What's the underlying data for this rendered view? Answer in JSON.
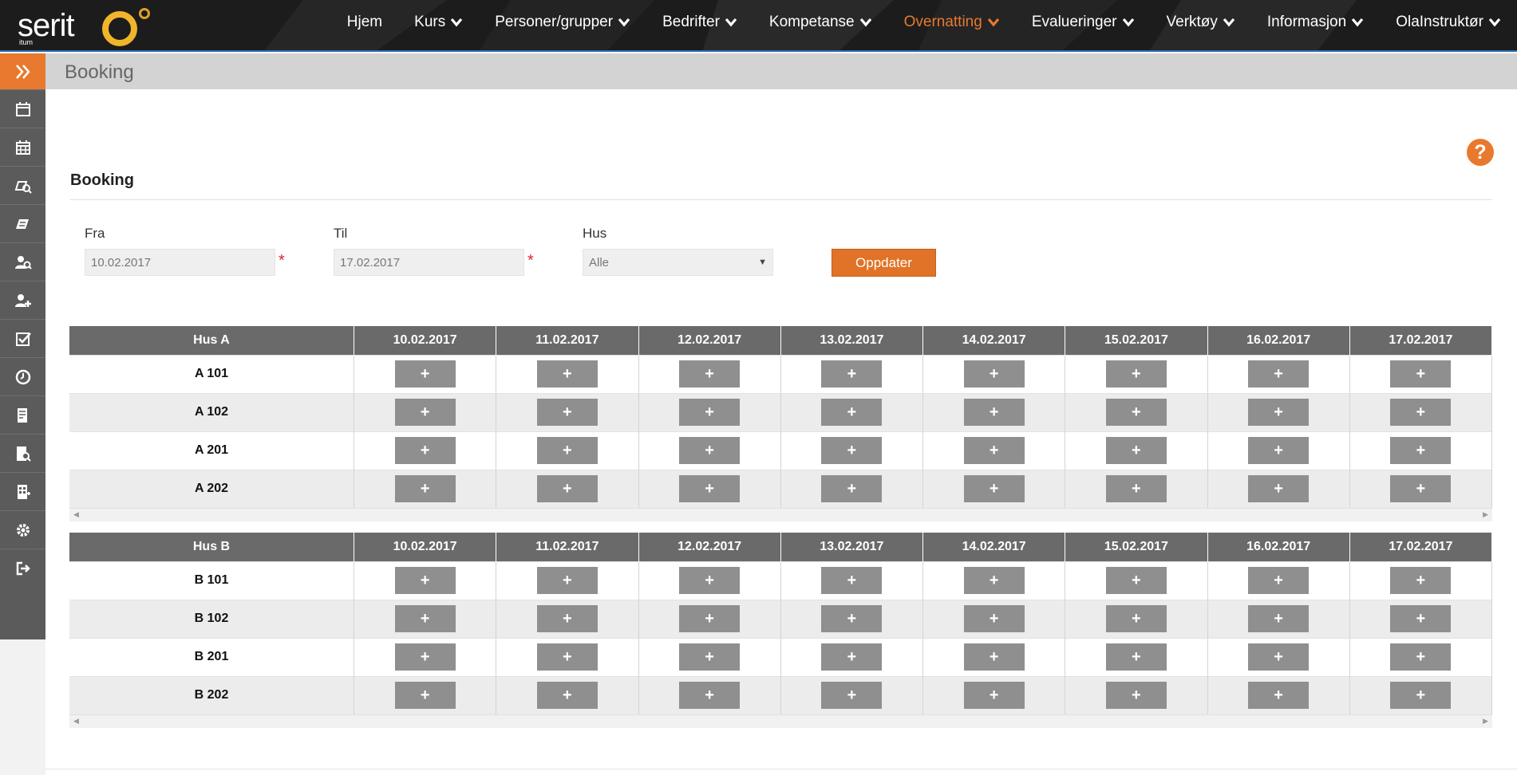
{
  "app": {
    "logo_text": "serit",
    "logo_sub": "itum"
  },
  "nav": {
    "items": [
      {
        "label": "Hjem",
        "dropdown": false,
        "active": false
      },
      {
        "label": "Kurs",
        "dropdown": true,
        "active": false
      },
      {
        "label": "Personer/grupper",
        "dropdown": true,
        "active": false
      },
      {
        "label": "Bedrifter",
        "dropdown": true,
        "active": false
      },
      {
        "label": "Kompetanse",
        "dropdown": true,
        "active": false
      },
      {
        "label": "Overnatting",
        "dropdown": true,
        "active": true
      },
      {
        "label": "Evalueringer",
        "dropdown": true,
        "active": false
      },
      {
        "label": "Verktøy",
        "dropdown": true,
        "active": false
      },
      {
        "label": "Informasjon",
        "dropdown": true,
        "active": false
      },
      {
        "label": "OlaInstruktør",
        "dropdown": true,
        "active": false
      }
    ]
  },
  "sidebar": {
    "toggle_icon": "double-chevron-right-icon",
    "items": [
      {
        "icon": "calendar-icon"
      },
      {
        "icon": "calendar-grid-icon"
      },
      {
        "icon": "course-search-icon"
      },
      {
        "icon": "course-edit-icon"
      },
      {
        "icon": "person-search-icon"
      },
      {
        "icon": "person-add-icon"
      },
      {
        "icon": "checkbox-icon"
      },
      {
        "icon": "clock-icon"
      },
      {
        "icon": "document-icon"
      },
      {
        "icon": "document-search-icon"
      },
      {
        "icon": "building-icon"
      },
      {
        "icon": "gear-icon"
      },
      {
        "icon": "logout-icon"
      }
    ]
  },
  "page": {
    "title": "Booking",
    "section_title": "Booking",
    "help_label": "?"
  },
  "form": {
    "from_label": "Fra",
    "from_value": "10.02.2017",
    "to_label": "Til",
    "to_value": "17.02.2017",
    "house_label": "Hus",
    "house_value": "Alle",
    "required_mark": "*",
    "update_button": "Oppdater"
  },
  "booking": {
    "dates": [
      "10.02.2017",
      "11.02.2017",
      "12.02.2017",
      "13.02.2017",
      "14.02.2017",
      "15.02.2017",
      "16.02.2017",
      "17.02.2017"
    ],
    "add_symbol": "+",
    "houses": [
      {
        "name": "Hus A",
        "rooms": [
          "A 101",
          "A 102",
          "A 201",
          "A 202"
        ]
      },
      {
        "name": "Hus B",
        "rooms": [
          "B 101",
          "B 102",
          "B 201",
          "B 202"
        ]
      }
    ]
  },
  "colors": {
    "accent": "#e8792e",
    "header_bg": "#1c1c1c",
    "sidebar_bg": "#5b5b5b",
    "table_header_bg": "#6a6a6a",
    "button_gray": "#8f8f8f"
  }
}
